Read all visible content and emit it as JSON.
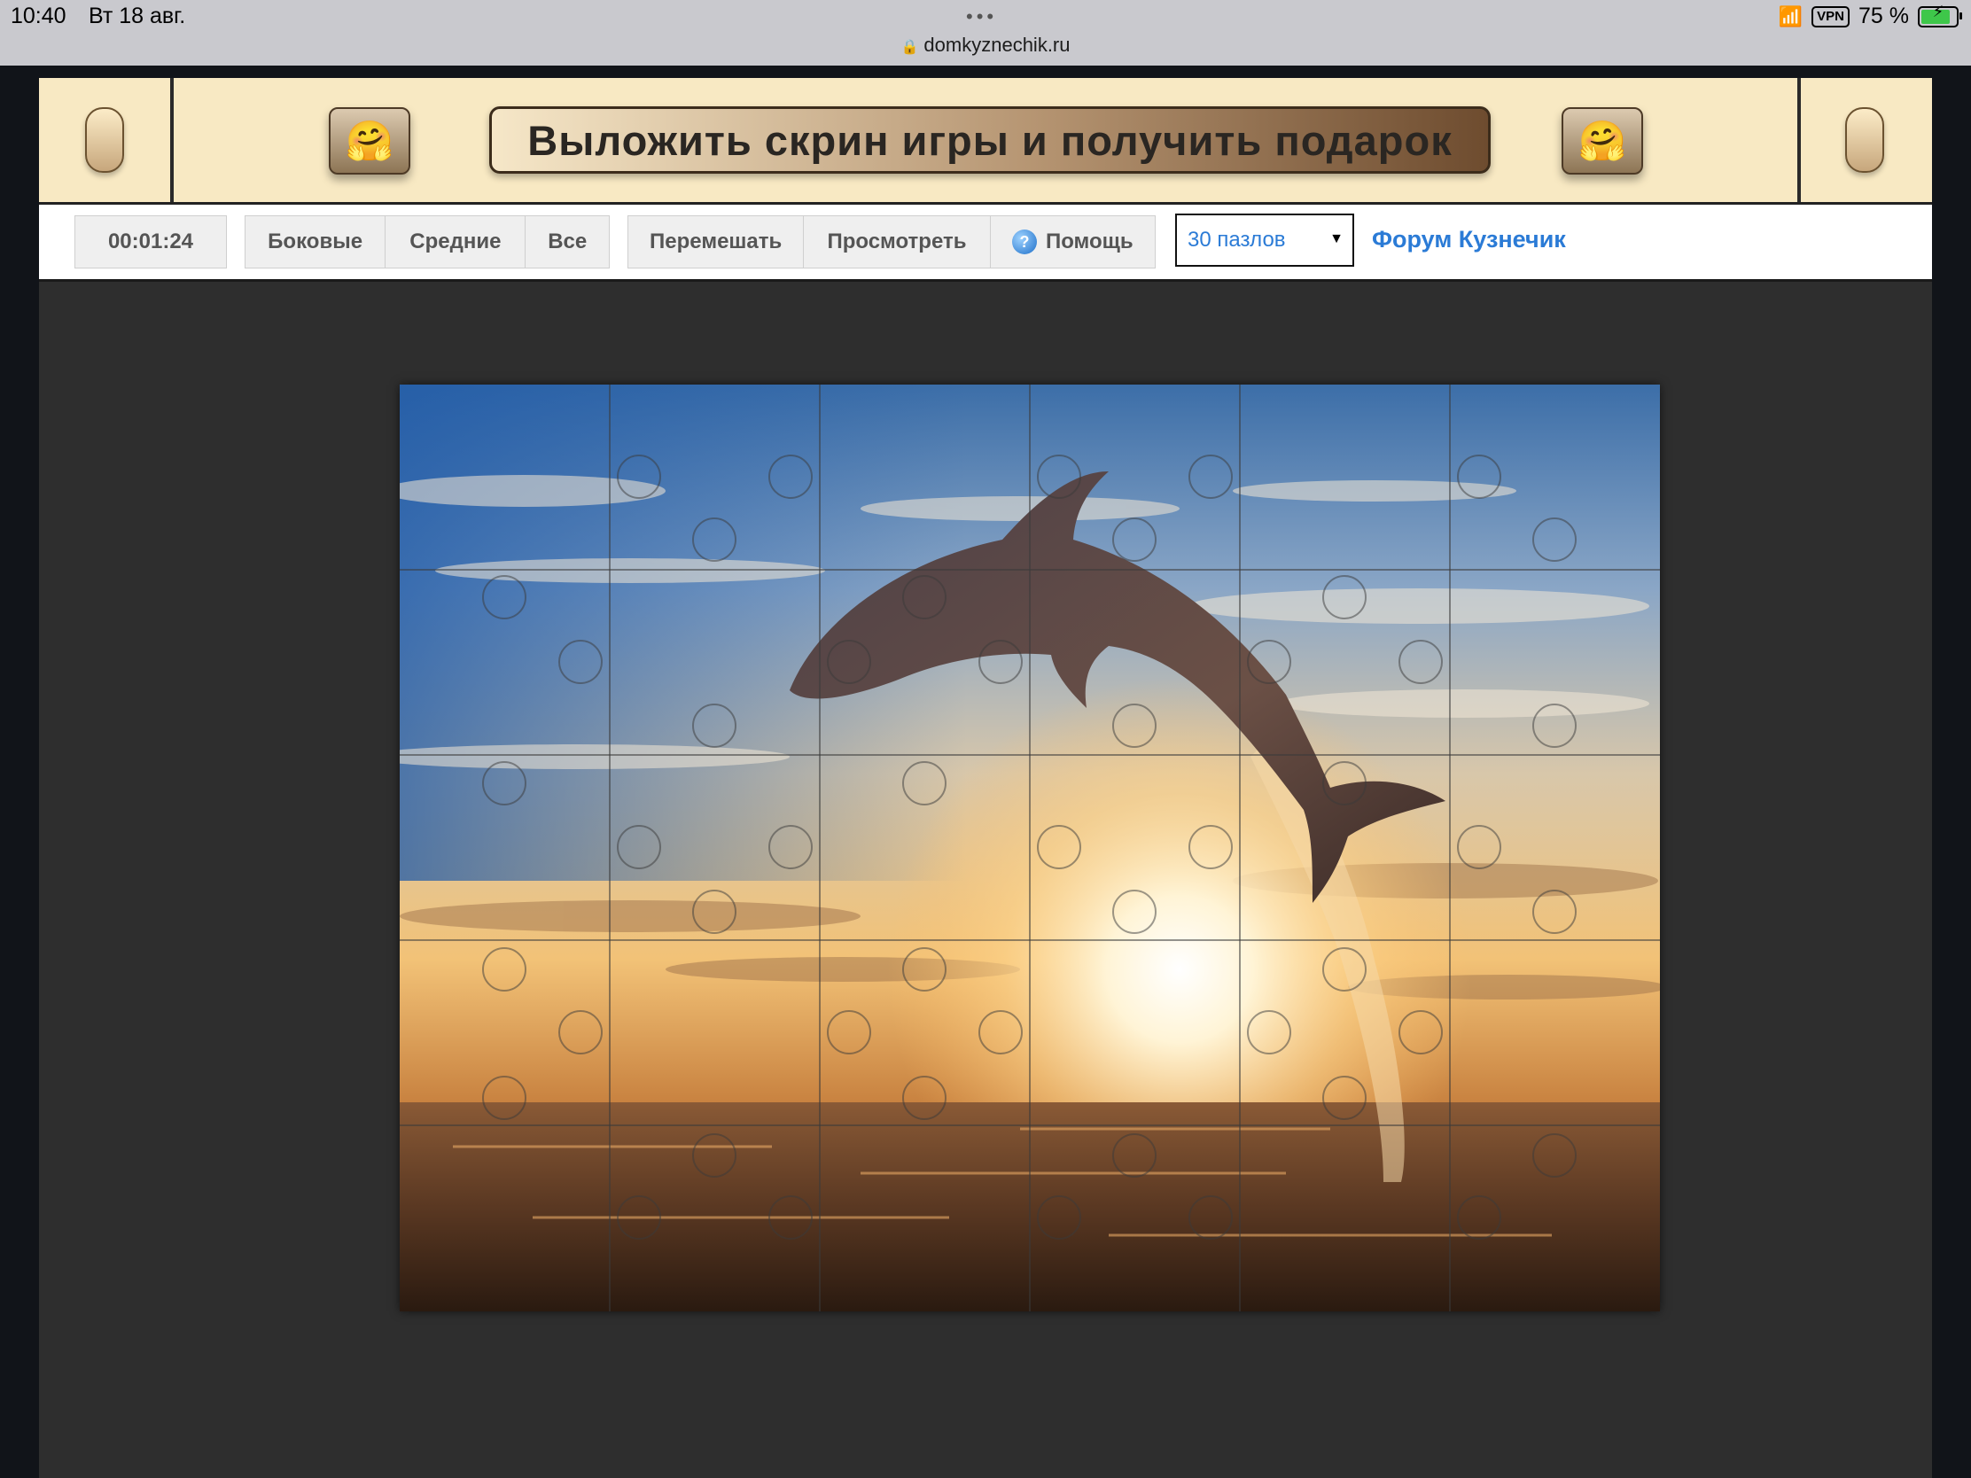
{
  "status_bar": {
    "time": "10:40",
    "date": "Вт 18 авг.",
    "url": "domkyznechik.ru",
    "vpn": "VPN",
    "battery": "75 %"
  },
  "banner": {
    "promo_text": "Выложить скрин игры и получить подарок",
    "emoji": "🤗"
  },
  "toolbar": {
    "timer": "00:01:24",
    "filters": [
      "Боковые",
      "Средние",
      "Все"
    ],
    "actions": {
      "shuffle": "Перемешать",
      "preview": "Просмотреть",
      "help": "Помощь"
    },
    "pieces_select": "30 пазлов",
    "forum_link": "Форум Кузнечик"
  },
  "puzzle": {
    "pieces": 30,
    "columns": 6,
    "rows": 5
  }
}
